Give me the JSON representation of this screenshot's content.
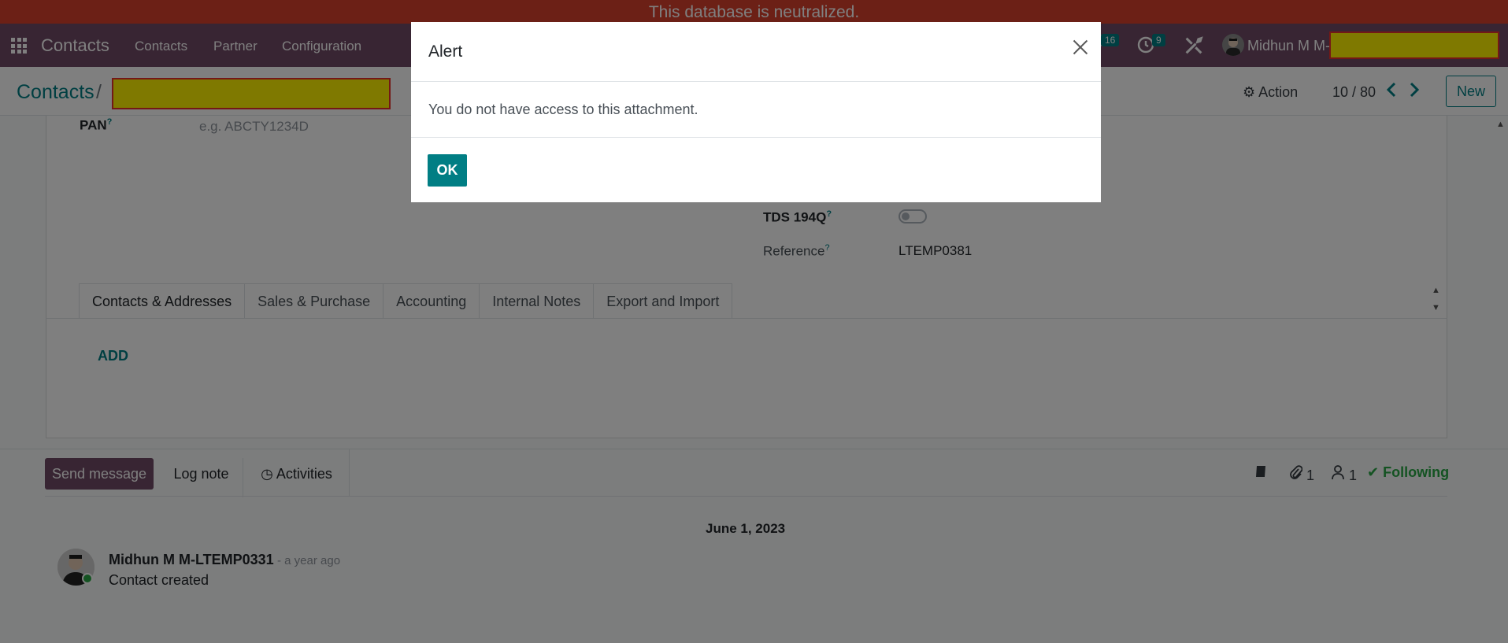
{
  "banner": {
    "text": "This database is neutralized."
  },
  "navbar": {
    "brand": "Contacts",
    "menu": [
      "Contacts",
      "Partner",
      "Configuration"
    ],
    "messages_badge": "16",
    "activities_badge": "9",
    "user_name": "Midhun M M-",
    "icons": [
      "apps-grid-icon",
      "chat-icon",
      "clock-icon",
      "tools-icon",
      "avatar"
    ]
  },
  "control_panel": {
    "breadcrumb_root": "Contacts",
    "breadcrumb_separator": "/",
    "action_label": "Action",
    "pager": "10 / 80",
    "new_label": "New"
  },
  "form": {
    "pan_label": "PAN",
    "pan_placeholder": "e.g. ABCTY1234D",
    "tds_label": "TDS 194Q",
    "tds_enabled": false,
    "reference_label": "Reference",
    "reference_value": "LTEMP0381",
    "help_mark": "?",
    "tabs": [
      "Contacts & Addresses",
      "Sales & Purchase",
      "Accounting",
      "Internal Notes",
      "Export and Import"
    ],
    "add_label": "ADD"
  },
  "chatter": {
    "send_message": "Send message",
    "log_note": "Log note",
    "activities": "Activities",
    "attachments_count": "1",
    "followers_count": "1",
    "following": "Following",
    "date": "June 1, 2023",
    "message": {
      "author": "Midhun M M-LTEMP0331",
      "time": "- a year ago",
      "body": "Contact created"
    }
  },
  "modal": {
    "title": "Alert",
    "body": "You do not have access to this attachment.",
    "ok_label": "OK"
  },
  "colors": {
    "banner": "#d9402c",
    "navbar": "#714b67",
    "primary": "#017e84",
    "redaction": "#fff200"
  }
}
